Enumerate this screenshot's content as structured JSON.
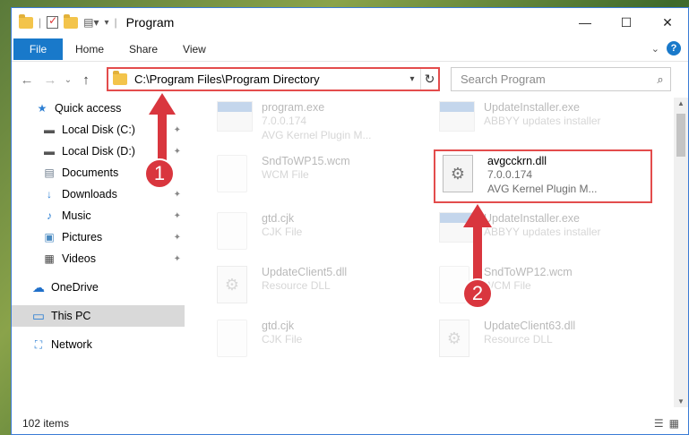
{
  "window": {
    "title": "Program",
    "controls": {
      "minimize": "—",
      "maximize": "☐",
      "close": "✕"
    }
  },
  "ribbon": {
    "tabs": [
      "File",
      "Home",
      "Share",
      "View"
    ],
    "help": "?"
  },
  "nav": {
    "back": "←",
    "forward": "→",
    "recent": "⌄",
    "up": "↑",
    "address": "C:\\Program Files\\Program Directory",
    "search_placeholder": "Search Program"
  },
  "sidebar": {
    "items": [
      {
        "label": "Quick access",
        "icon": "star-icon",
        "glyph": "★"
      },
      {
        "label": "Local Disk (C:)",
        "icon": "drive-icon",
        "glyph": "▬"
      },
      {
        "label": "Local Disk (D:)",
        "icon": "drive-icon",
        "glyph": "▬"
      },
      {
        "label": "Documents",
        "icon": "document-icon",
        "glyph": "▤"
      },
      {
        "label": "Downloads",
        "icon": "download-icon",
        "glyph": "↓"
      },
      {
        "label": "Music",
        "icon": "music-icon",
        "glyph": "♪"
      },
      {
        "label": "Pictures",
        "icon": "picture-icon",
        "glyph": "▣"
      },
      {
        "label": "Videos",
        "icon": "video-icon",
        "glyph": "▦"
      },
      {
        "label": "OneDrive",
        "icon": "cloud-icon",
        "glyph": "☁"
      },
      {
        "label": "This PC",
        "icon": "computer-icon",
        "glyph": "▭"
      },
      {
        "label": "Network",
        "icon": "network-icon",
        "glyph": "⛶"
      }
    ]
  },
  "files": [
    {
      "name": "program.exe",
      "line2": "7.0.0.174",
      "line3": "AVG Kernel Plugin M..."
    },
    {
      "name": "UpdateInstaller.exe",
      "line2": "ABBYY updates installer",
      "line3": ""
    },
    {
      "name": "SndToWP15.wcm",
      "line2": "WCM File",
      "line3": ""
    },
    {
      "name": "avgcckrn.dll",
      "line2": "7.0.0.174",
      "line3": "AVG Kernel Plugin M..."
    },
    {
      "name": "gtd.cjk",
      "line2": "CJK File",
      "line3": ""
    },
    {
      "name": "UpdateInstaller.exe",
      "line2": "ABBYY updates installer",
      "line3": ""
    },
    {
      "name": "UpdateClient5.dll",
      "line2": "Resource DLL",
      "line3": ""
    },
    {
      "name": "SndToWP12.wcm",
      "line2": "WCM File",
      "line3": ""
    },
    {
      "name": "gtd.cjk",
      "line2": "CJK File",
      "line3": ""
    },
    {
      "name": "UpdateClient63.dll",
      "line2": "Resource DLL",
      "line3": ""
    }
  ],
  "status": {
    "items": "102 items"
  },
  "annotations": {
    "one": "1",
    "two": "2"
  },
  "colors": {
    "accent": "#1979ca",
    "highlight": "#e34c4c",
    "badge": "#d9363e"
  }
}
